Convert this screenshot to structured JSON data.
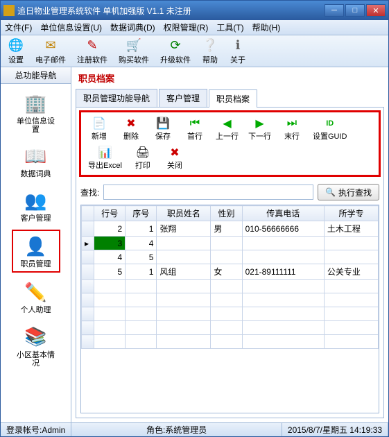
{
  "window": {
    "title": "追日物业管理系统软件 单机加强版 V1.1 未注册"
  },
  "menu": [
    "文件(F)",
    "单位信息设置(U)",
    "数据词典(D)",
    "权限管理(R)",
    "工具(T)",
    "帮助(H)"
  ],
  "toolbar": [
    {
      "label": "设置"
    },
    {
      "label": "电子邮件"
    },
    {
      "label": "注册软件"
    },
    {
      "label": "购买软件"
    },
    {
      "label": "升级软件"
    },
    {
      "label": "帮助"
    },
    {
      "label": "关于"
    }
  ],
  "sidebar": {
    "tab": "总功能导航",
    "items": [
      {
        "label": "单位信息设置"
      },
      {
        "label": "数据词典"
      },
      {
        "label": "客户管理"
      },
      {
        "label": "职员管理"
      },
      {
        "label": "个人助理"
      },
      {
        "label": "小区基本情况"
      }
    ]
  },
  "crumb": "职员档案",
  "tabs": [
    "职员管理功能导航",
    "客户管理",
    "职员档案"
  ],
  "active_tab": 2,
  "ribbon": [
    {
      "label": "新增"
    },
    {
      "label": "删除"
    },
    {
      "label": "保存"
    },
    {
      "label": "首行"
    },
    {
      "label": "上一行"
    },
    {
      "label": "下一行"
    },
    {
      "label": "末行"
    },
    {
      "label": "设置GUID"
    },
    {
      "label": "导出Excel"
    },
    {
      "label": "打印"
    },
    {
      "label": "关闭"
    }
  ],
  "search": {
    "label": "查找:",
    "button": "执行查找",
    "value": ""
  },
  "grid": {
    "headers": [
      "行号",
      "序号",
      "职员姓名",
      "性别",
      "传真电话",
      "所学专"
    ],
    "rows": [
      {
        "rn": "2",
        "xh": "1",
        "name": "张翔",
        "sex": "男",
        "fax": "010-56666666",
        "major": "土木工程"
      },
      {
        "rn": "3",
        "xh": "4",
        "name": "",
        "sex": "",
        "fax": "",
        "major": ""
      },
      {
        "rn": "4",
        "xh": "5",
        "name": "",
        "sex": "",
        "fax": "",
        "major": ""
      },
      {
        "rn": "5",
        "xh": "1",
        "name": "风组",
        "sex": "女",
        "fax": "021-89111111",
        "major": "公关专业"
      }
    ]
  },
  "status": {
    "login": "登录帐号:Admin",
    "role": "角色:系统管理员",
    "datetime": "2015/8/7/星期五 14:19:33"
  }
}
